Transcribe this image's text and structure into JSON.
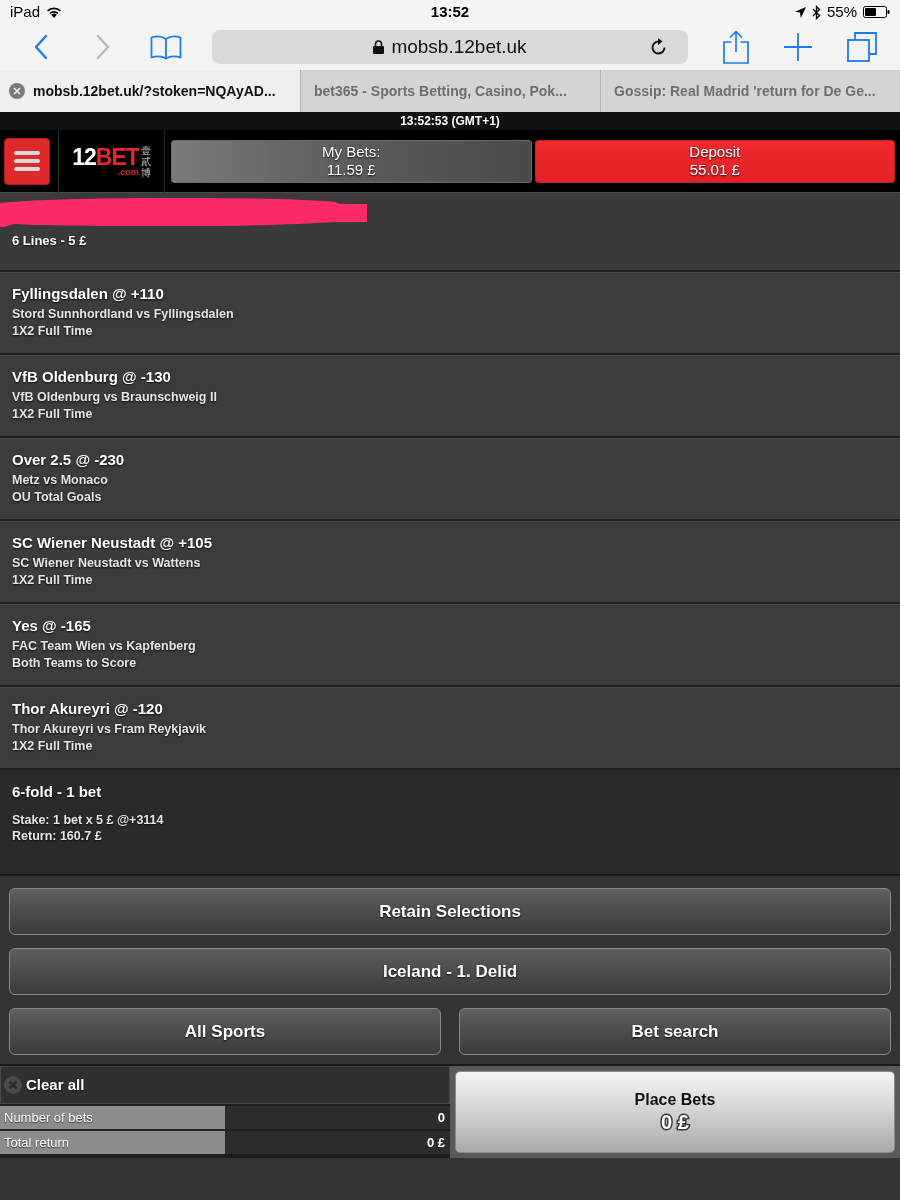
{
  "status_bar": {
    "device": "iPad",
    "time": "13:52",
    "battery": "55%"
  },
  "browser": {
    "nav": [
      {
        "kind": "back",
        "disabled": false
      },
      {
        "kind": "forward",
        "disabled": true
      }
    ],
    "url": "mobsb.12bet.uk",
    "tabs": [
      {
        "title": "mobsb.12bet.uk/?stoken=NQAyAD...",
        "selected": true
      },
      {
        "title": "bet365 - Sports Betting, Casino, Pok...",
        "selected": false
      },
      {
        "title": "Gossip: Real Madrid 'return for De Ge...",
        "selected": false
      }
    ]
  },
  "clock": "13:52:53 (GMT+1)",
  "header": {
    "logo": {
      "number": "12",
      "name": "BET",
      "domain": ".com",
      "cjk": "壹貳博"
    },
    "my_bets": {
      "label": "My Bets:",
      "amount": "11.59 £"
    },
    "deposit": {
      "label": "Deposit",
      "amount": "55.01 £"
    }
  },
  "bet_slip": {
    "combo": {
      "title_redacted": true,
      "line": "6 Lines - 5 £"
    },
    "selections": [
      {
        "title": "Fyllingsdalen @ +110",
        "match": "Stord Sunnhordland vs Fyllingsdalen",
        "market": "1X2 Full Time"
      },
      {
        "title": "VfB Oldenburg @ -130",
        "match": "VfB Oldenburg vs Braunschweig II",
        "market": "1X2 Full Time"
      },
      {
        "title": "Over 2.5 @ -230",
        "match": "Metz vs Monaco",
        "market": "OU Total Goals"
      },
      {
        "title": "SC Wiener Neustadt @ +105",
        "match": "SC Wiener Neustadt vs Wattens",
        "market": "1X2 Full Time"
      },
      {
        "title": "Yes @ -165",
        "match": "FAC Team Wien vs Kapfenberg",
        "market": "Both Teams to Score"
      },
      {
        "title": "Thor Akureyri @ -120",
        "match": "Thor Akureyri vs Fram Reykjavik",
        "market": "1X2 Full Time"
      }
    ],
    "summary": {
      "title": "6-fold - 1 bet",
      "stake": "Stake: 1 bet x 5 £ @+3114",
      "return": "Return: 160.7 £"
    }
  },
  "action_rows": [
    [
      "Retain Selections"
    ],
    [
      "Iceland - 1. Delid"
    ],
    [
      "All Sports",
      "Bet search"
    ]
  ],
  "footer": {
    "clear_all": "Clear all",
    "stats": [
      {
        "label": "Number of bets",
        "value": "0"
      },
      {
        "label": "Total return",
        "value": "0 £"
      }
    ],
    "place_bets": {
      "label": "Place Bets",
      "amount": "0 £"
    }
  }
}
